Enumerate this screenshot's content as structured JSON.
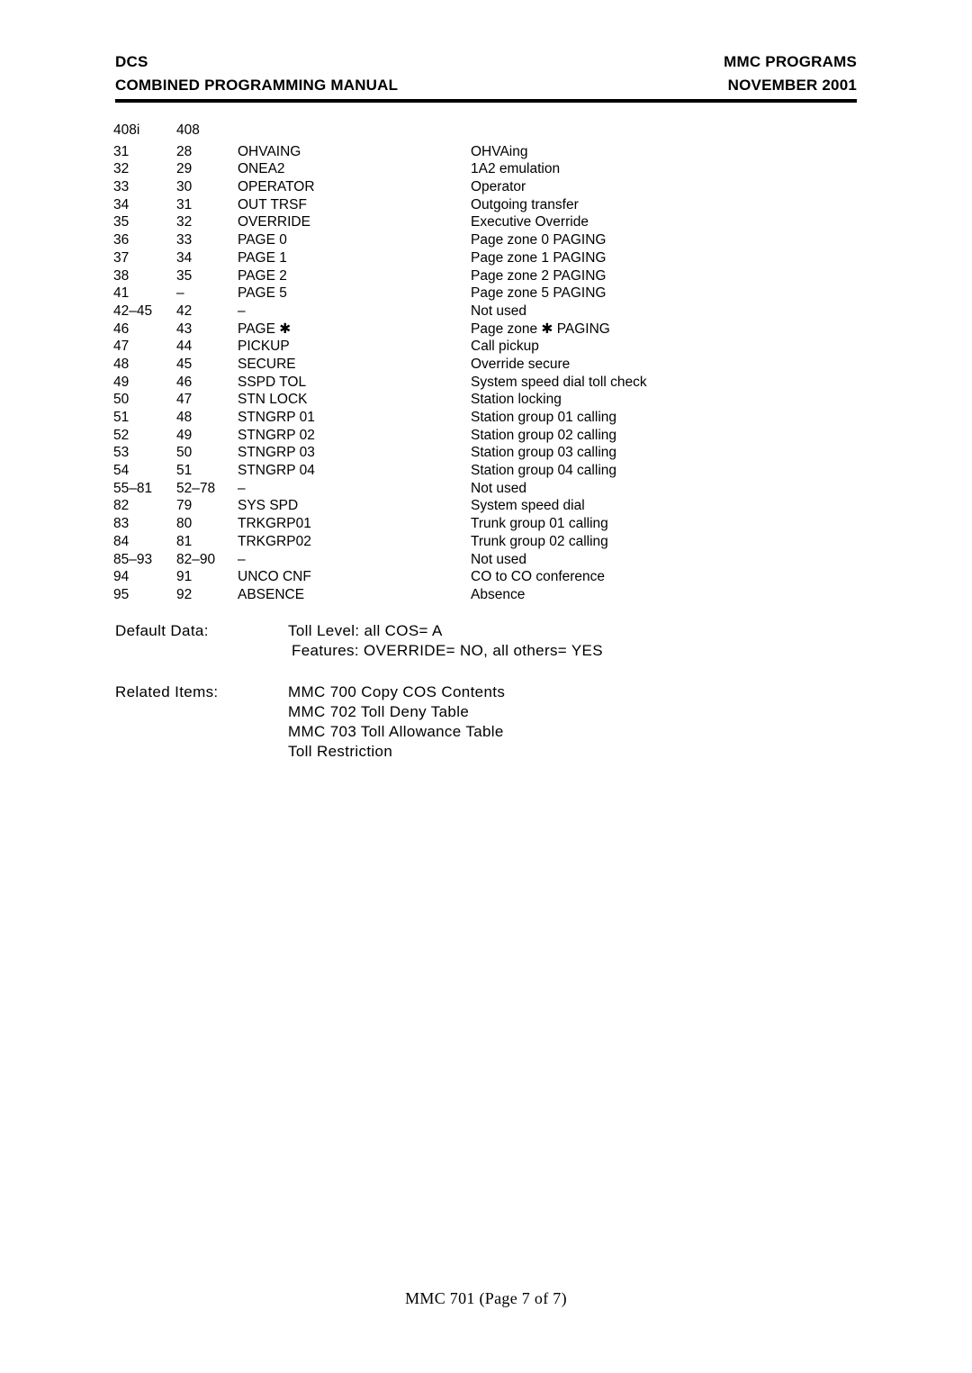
{
  "header": {
    "left_line1": "DCS",
    "left_line2": "COMBINED PROGRAMMING MANUAL",
    "right_line1": "MMC PROGRAMS",
    "right_line2": "NOVEMBER 2001"
  },
  "table": {
    "columns": [
      "408i",
      "408",
      "",
      ""
    ],
    "column_headers": {
      "col1": "408i",
      "col2": "408",
      "col3": "",
      "col4": ""
    },
    "rows": [
      {
        "c1": "31",
        "c2": "28",
        "c3": "OHVAING",
        "c4": "OHVAing"
      },
      {
        "c1": "32",
        "c2": "29",
        "c3": "ONEA2",
        "c4": "1A2 emulation"
      },
      {
        "c1": "33",
        "c2": "30",
        "c3": "OPERATOR",
        "c4": "Operator"
      },
      {
        "c1": "34",
        "c2": "31",
        "c3": "OUT TRSF",
        "c4": "Outgoing transfer"
      },
      {
        "c1": "35",
        "c2": "32",
        "c3": "OVERRIDE",
        "c4": "Executive Override"
      },
      {
        "c1": "36",
        "c2": "33",
        "c3": "PAGE 0",
        "c4": "Page zone 0 PAGING"
      },
      {
        "c1": "37",
        "c2": "34",
        "c3": "PAGE 1",
        "c4": "Page zone 1 PAGING"
      },
      {
        "c1": "38",
        "c2": "35",
        "c3": "PAGE 2",
        "c4": "Page zone 2 PAGING"
      },
      {
        "c1": "41",
        "c2": "–",
        "c3": "PAGE 5",
        "c4": "Page zone 5 PAGING"
      },
      {
        "c1": "42–45",
        "c2": "42",
        "c3": "–",
        "c4": "Not used"
      },
      {
        "c1": "46",
        "c2": "43",
        "c3": "PAGE ✱",
        "c4": "Page zone ✱ PAGING"
      },
      {
        "c1": "47",
        "c2": "44",
        "c3": "PICKUP",
        "c4": "Call pickup"
      },
      {
        "c1": "48",
        "c2": "45",
        "c3": "SECURE",
        "c4": "Override secure"
      },
      {
        "c1": "49",
        "c2": "46",
        "c3": "SSPD TOL",
        "c4": "System speed dial toll check"
      },
      {
        "c1": "50",
        "c2": "47",
        "c3": "STN LOCK",
        "c4": "Station locking"
      },
      {
        "c1": "51",
        "c2": "48",
        "c3": "STNGRP 01",
        "c4": "Station group 01 calling"
      },
      {
        "c1": "52",
        "c2": "49",
        "c3": "STNGRP 02",
        "c4": "Station group 02 calling"
      },
      {
        "c1": "53",
        "c2": "50",
        "c3": "STNGRP 03",
        "c4": "Station group 03 calling"
      },
      {
        "c1": "54",
        "c2": "51",
        "c3": "STNGRP 04",
        "c4": "Station group 04 calling"
      },
      {
        "c1": "55–81",
        "c2": "52–78",
        "c3": "–",
        "c4": "Not used"
      },
      {
        "c1": "82",
        "c2": "79",
        "c3": "SYS SPD",
        "c4": "System speed dial"
      },
      {
        "c1": "83",
        "c2": "80",
        "c3": "TRKGRP01",
        "c4": "Trunk group 01 calling"
      },
      {
        "c1": "84",
        "c2": "81",
        "c3": "TRKGRP02",
        "c4": "Trunk group 02 calling"
      },
      {
        "c1": "85–93",
        "c2": "82–90",
        "c3": "–",
        "c4": "Not used"
      },
      {
        "c1": "94",
        "c2": "91",
        "c3": "UNCO CNF",
        "c4": "CO to CO conference"
      },
      {
        "c1": "95",
        "c2": "92",
        "c3": "ABSENCE",
        "c4": "Absence"
      }
    ]
  },
  "default_data": {
    "label": "Default Data:",
    "lines": [
      "Toll Level: all COS= A",
      "Features:  OVERRIDE= NO, all others= YES"
    ]
  },
  "related_items": {
    "label": "Related Items:",
    "lines": [
      "MMC 700 Copy COS Contents",
      "MMC 702 Toll Deny Table",
      "MMC 703 Toll Allowance Table",
      "Toll Restriction"
    ]
  },
  "footer": {
    "text": "MMC 701 (Page 7 of 7)"
  }
}
